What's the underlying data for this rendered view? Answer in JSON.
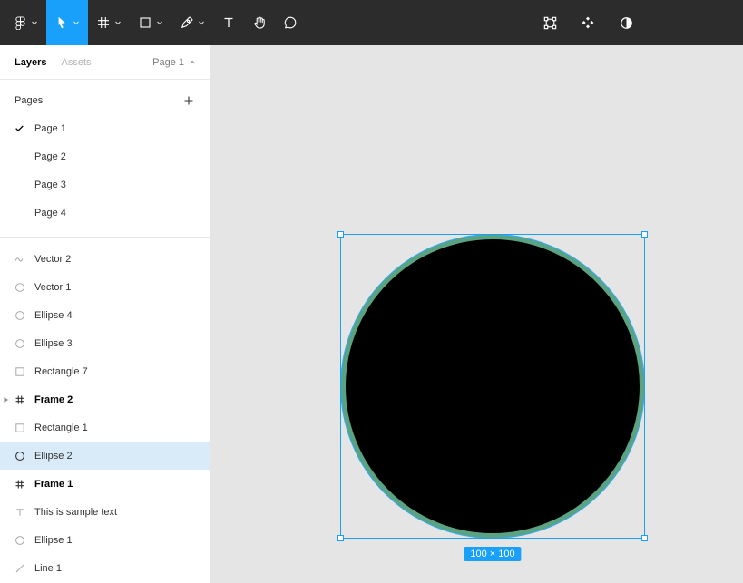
{
  "colors": {
    "accent_blue": "#18a0fb",
    "toolbar_bg": "#2c2c2c",
    "canvas_bg": "#e5e5e5",
    "selected_row_bg": "#d9eaf8",
    "ellipse_fill": "#000000",
    "ellipse_stroke": "#5aa382"
  },
  "toolbar": {
    "left_tools": [
      {
        "id": "main-menu",
        "icon": "figma-logo-icon",
        "chevron": true
      },
      {
        "id": "move-tool",
        "icon": "move-cursor-icon",
        "chevron": true,
        "active": true
      },
      {
        "id": "frame-tool",
        "icon": "frame-hash-icon",
        "chevron": true
      },
      {
        "id": "shape-tool",
        "icon": "rectangle-icon",
        "chevron": true
      },
      {
        "id": "pen-tool",
        "icon": "pen-icon",
        "chevron": true
      },
      {
        "id": "text-tool",
        "icon": "text-icon",
        "chevron": false
      },
      {
        "id": "hand-tool",
        "icon": "hand-icon",
        "chevron": false
      },
      {
        "id": "comment-tool",
        "icon": "comment-bubble-icon",
        "chevron": false
      }
    ],
    "right_tools": [
      {
        "id": "edit-object",
        "icon": "edit-object-icon"
      },
      {
        "id": "create-component",
        "icon": "component-diamonds-icon"
      },
      {
        "id": "use-as-mask",
        "icon": "mask-half-circle-icon"
      }
    ]
  },
  "sidebar": {
    "tabs": [
      {
        "label": "Layers",
        "active": true
      },
      {
        "label": "Assets",
        "active": false
      }
    ],
    "page_selector": "Page 1",
    "pages_header": "Pages",
    "pages": [
      {
        "name": "Page 1",
        "checked": true
      },
      {
        "name": "Page 2",
        "checked": false
      },
      {
        "name": "Page 3",
        "checked": false
      },
      {
        "name": "Page 4",
        "checked": false
      }
    ],
    "layers": [
      {
        "name": "Vector 2",
        "icon": "vector-path-icon"
      },
      {
        "name": "Vector 1",
        "icon": "vector-circle-icon"
      },
      {
        "name": "Ellipse 4",
        "icon": "ellipse-icon"
      },
      {
        "name": "Ellipse 3",
        "icon": "ellipse-icon"
      },
      {
        "name": "Rectangle 7",
        "icon": "rectangle-icon"
      },
      {
        "name": "Frame 2",
        "icon": "frame-hash-icon",
        "bold": true,
        "expandable": true
      },
      {
        "name": "Rectangle 1",
        "icon": "rectangle-icon"
      },
      {
        "name": "Ellipse 2",
        "icon": "ellipse-icon",
        "selected": true
      },
      {
        "name": "Frame 1",
        "icon": "frame-hash-icon",
        "bold": true
      },
      {
        "name": "This is sample text",
        "icon": "text-icon"
      },
      {
        "name": "Ellipse 1",
        "icon": "ellipse-icon"
      },
      {
        "name": "Line 1",
        "icon": "line-icon"
      }
    ]
  },
  "canvas": {
    "selection_size_label": "100 × 100"
  }
}
